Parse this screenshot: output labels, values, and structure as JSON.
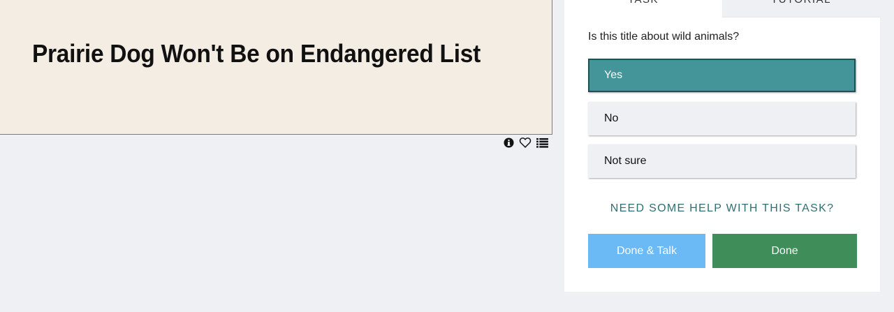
{
  "subject": {
    "title": "Prairie Dog Won't Be on Endangered List",
    "tools": [
      {
        "icon": "info-icon"
      },
      {
        "icon": "heart-icon"
      },
      {
        "icon": "list-icon"
      }
    ]
  },
  "task": {
    "tabs": [
      {
        "label": "TASK"
      },
      {
        "label": "TUTORIAL"
      }
    ],
    "question": "Is this title about wild animals?",
    "answers": [
      {
        "label": "Yes",
        "selected": true
      },
      {
        "label": "No",
        "selected": false
      },
      {
        "label": "Not sure",
        "selected": false
      }
    ],
    "help_link": "NEED SOME HELP WITH THIS TASK?",
    "buttons": {
      "done_talk": "Done & Talk",
      "done": "Done"
    }
  },
  "colors": {
    "background": "#eef0f3",
    "subject_background": "#f4ede3",
    "selected_answer": "#43959a",
    "done_talk": "#6bbaf5",
    "done": "#3f8d58",
    "help_link": "#2f6f73"
  }
}
